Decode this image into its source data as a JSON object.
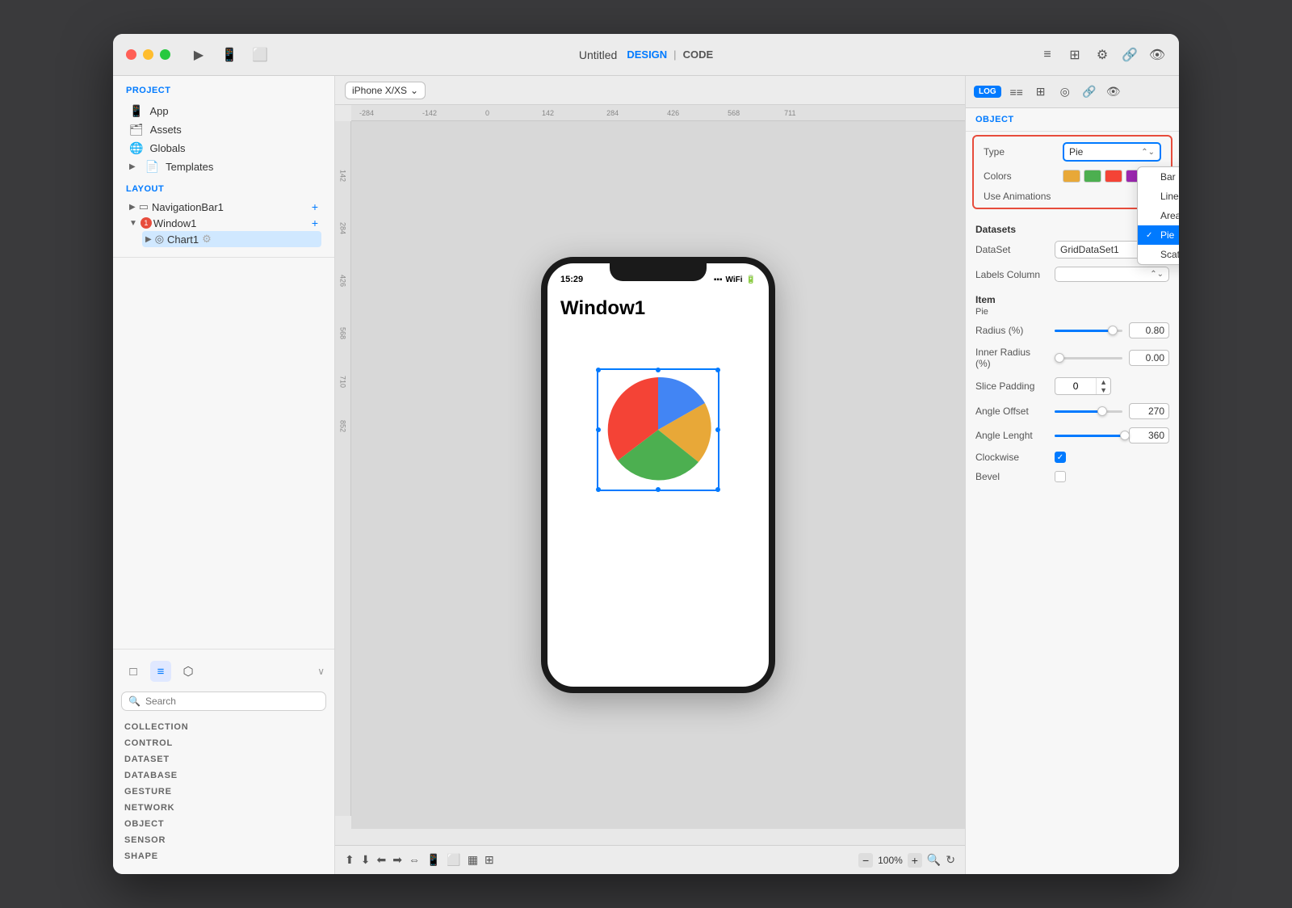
{
  "window": {
    "title": "Untitled",
    "design_label": "DESIGN",
    "code_label": "CODE"
  },
  "sidebar": {
    "project_label": "PROJECT",
    "items": [
      {
        "label": "App",
        "icon": "📱"
      },
      {
        "label": "Assets",
        "icon": "🗂"
      },
      {
        "label": "Globals",
        "icon": "🌐"
      },
      {
        "label": "Templates",
        "icon": "📄"
      }
    ],
    "layout_label": "LAYOUT",
    "tree": [
      {
        "label": "NavigationBar1",
        "icon": "▭",
        "depth": 0
      },
      {
        "label": "Window1",
        "icon": "⬜",
        "depth": 0,
        "badge": "1"
      },
      {
        "label": "Chart1",
        "icon": "◎",
        "depth": 1
      }
    ]
  },
  "bottom_panel": {
    "tabs": [
      "□",
      "≡",
      "⬡"
    ],
    "search_placeholder": "Search",
    "categories": [
      "COLLECTION",
      "CONTROL",
      "DATASET",
      "DATABASE",
      "GESTURE",
      "NETWORK",
      "OBJECT",
      "SENSOR",
      "SHAPE"
    ]
  },
  "canvas": {
    "device": "iPhone X/XS",
    "window_title": "Window1",
    "status_time": "15:29",
    "zoom": "100%"
  },
  "right_panel": {
    "object_label": "OBJECT",
    "type_label": "Type",
    "type_value": "Pie",
    "colors_label": "Colors",
    "use_animations_label": "Use Animations",
    "dropdown_items": [
      {
        "label": "Bar",
        "selected": false
      },
      {
        "label": "Line",
        "selected": false
      },
      {
        "label": "Area",
        "selected": false
      },
      {
        "label": "Pie",
        "selected": true
      },
      {
        "label": "Scatter",
        "selected": false
      }
    ],
    "datasets_label": "Datasets",
    "dataset_label": "DataSet",
    "dataset_value": "GridDataSet1",
    "labels_column_label": "Labels Column",
    "item_label": "Item",
    "pie_label": "Pie",
    "radius_label": "Radius (%)",
    "radius_value": "0.80",
    "radius_fill": 80,
    "inner_radius_label": "Inner Radius (%)",
    "inner_radius_value": "0.00",
    "inner_radius_fill": 0,
    "slice_padding_label": "Slice Padding",
    "slice_padding_value": "0",
    "angle_offset_label": "Angle Offset",
    "angle_offset_value": "270",
    "angle_offset_fill": 65,
    "angle_length_label": "Angle Lenght",
    "angle_length_value": "360",
    "angle_length_fill": 100,
    "clockwise_label": "Clockwise",
    "clockwise_checked": true,
    "bevel_label": "Bevel",
    "bevel_checked": false,
    "colors_swatches": [
      "#e8a838",
      "#4caf50",
      "#f44336",
      "#9c27b0",
      "#2196f3",
      "#ff9800"
    ],
    "colors_swatches2": [
      "#4caf50",
      "#9c27b0"
    ]
  },
  "ruler": {
    "top_marks": [
      "-284",
      "-142",
      "0",
      "142",
      "284",
      "426",
      "568",
      "711"
    ],
    "left_marks": [
      "142",
      "284",
      "426",
      "568",
      "710",
      "852"
    ]
  },
  "toolbar_icons": [
    "▶",
    "📱",
    "📋"
  ],
  "right_icons": [
    "log",
    "≡≡",
    "⊞",
    "☯",
    "🔗",
    "👁"
  ]
}
